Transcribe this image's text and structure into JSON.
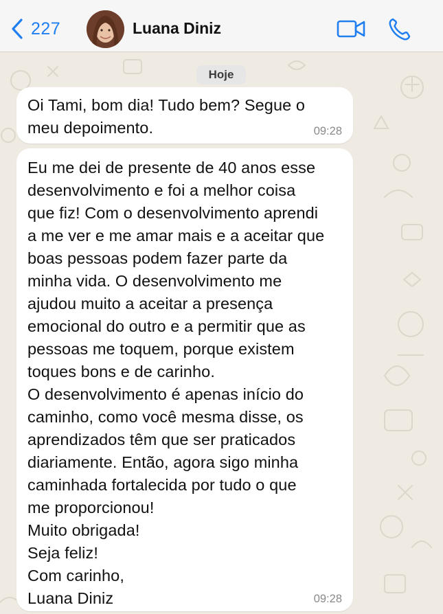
{
  "header": {
    "back_count": "227",
    "contact_name": "Luana Diniz"
  },
  "date_chip": "Hoje",
  "messages": [
    {
      "text": "Oi Tami, bom dia! Tudo bem? Segue o\nmeu depoimento.",
      "time": "09:28"
    },
    {
      "text": "Eu me dei de presente de 40 anos esse\ndesenvolvimento e foi a melhor coisa\nque fiz! Com o desenvolvimento aprendi\na me ver e me amar mais e a aceitar que\nboas pessoas podem fazer parte da\nminha vida. O desenvolvimento me\najudou muito a aceitar a presença\nemocional do outro e a permitir que as\npessoas me toquem, porque existem\ntoques bons e de carinho.\nO desenvolvimento é apenas início do\ncaminho, como você mesma disse, os\naprendizados têm que ser praticados\ndiariamente. Então, agora sigo minha\ncaminhada fortalecida por tudo o que\nme proporcionou!\nMuito obrigada!\nSeja feliz!\nCom carinho,\nLuana Diniz",
      "time": "09:28"
    }
  ],
  "icons": {
    "back": "chevron-left-icon",
    "video": "video-camera-icon",
    "phone": "phone-icon"
  },
  "colors": {
    "accent": "#1f7ff0",
    "wallpaper": "#efeae2",
    "bubble": "#ffffff"
  }
}
